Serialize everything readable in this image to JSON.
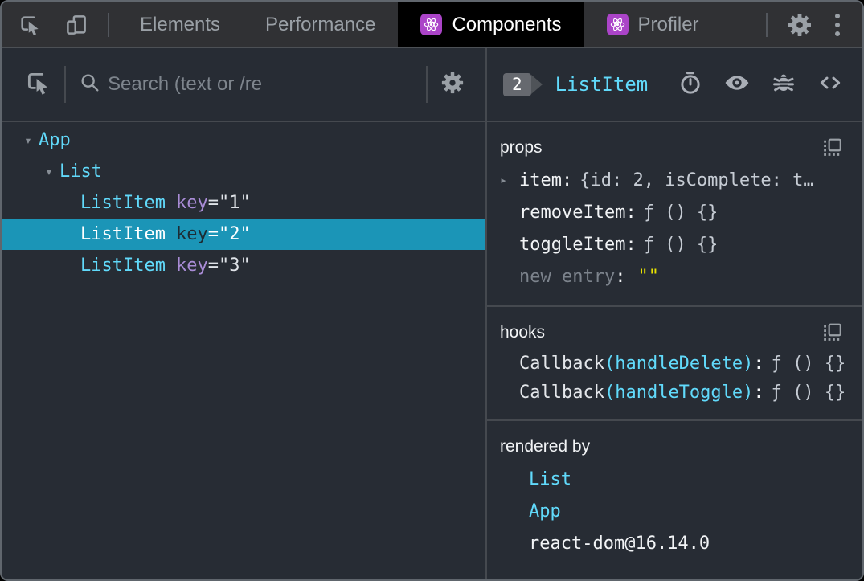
{
  "icons": {
    "caret_down": "▾",
    "caret_right": "▸"
  },
  "toolbar": {
    "tabs": [
      {
        "label": "Elements",
        "active": false
      },
      {
        "label": "Performance",
        "active": false
      },
      {
        "label": "Components",
        "active": true
      },
      {
        "label": "Profiler",
        "active": false
      }
    ]
  },
  "left": {
    "search_placeholder": "Search (text or /re",
    "tree": [
      {
        "name": "App"
      },
      {
        "name": "List"
      },
      {
        "name": "ListItem",
        "attr": "key",
        "eqval": "=\"1\""
      },
      {
        "name": "ListItem",
        "attr": "key",
        "eqval": "=\"2\"",
        "selected": true
      },
      {
        "name": "ListItem",
        "attr": "key",
        "eqval": "=\"3\""
      }
    ]
  },
  "right": {
    "header": {
      "key_badge": "2",
      "component": "ListItem"
    },
    "props": {
      "title": "props",
      "rows": [
        {
          "name": "item",
          "sep": ":",
          "value": "{id: 2, isComplete: t…"
        },
        {
          "name": "removeItem",
          "sep": ":",
          "value": "ƒ () {}"
        },
        {
          "name": "toggleItem",
          "sep": ":",
          "value": "ƒ () {}"
        },
        {
          "name": "new entry",
          "sep": ":",
          "value": "\"\""
        }
      ]
    },
    "hooks": {
      "title": "hooks",
      "rows": [
        {
          "name": "Callback",
          "paren": "(handleDelete)",
          "sep": ":",
          "value": "ƒ () {}"
        },
        {
          "name": "Callback",
          "paren": "(handleToggle)",
          "sep": ":",
          "value": "ƒ () {}"
        }
      ]
    },
    "rendered_by": {
      "title": "rendered by",
      "items": [
        "List",
        "App",
        "react-dom@16.14.0"
      ]
    }
  },
  "colors": {
    "accent_cyan": "#61dafb",
    "attr_purple": "#a98cd6",
    "selected_bg": "#1b95b7",
    "editable_yellow": "#e9e400",
    "react_badge": "#ab44c8",
    "panel_bg": "#272c34",
    "toolbar_bg": "#303134"
  }
}
